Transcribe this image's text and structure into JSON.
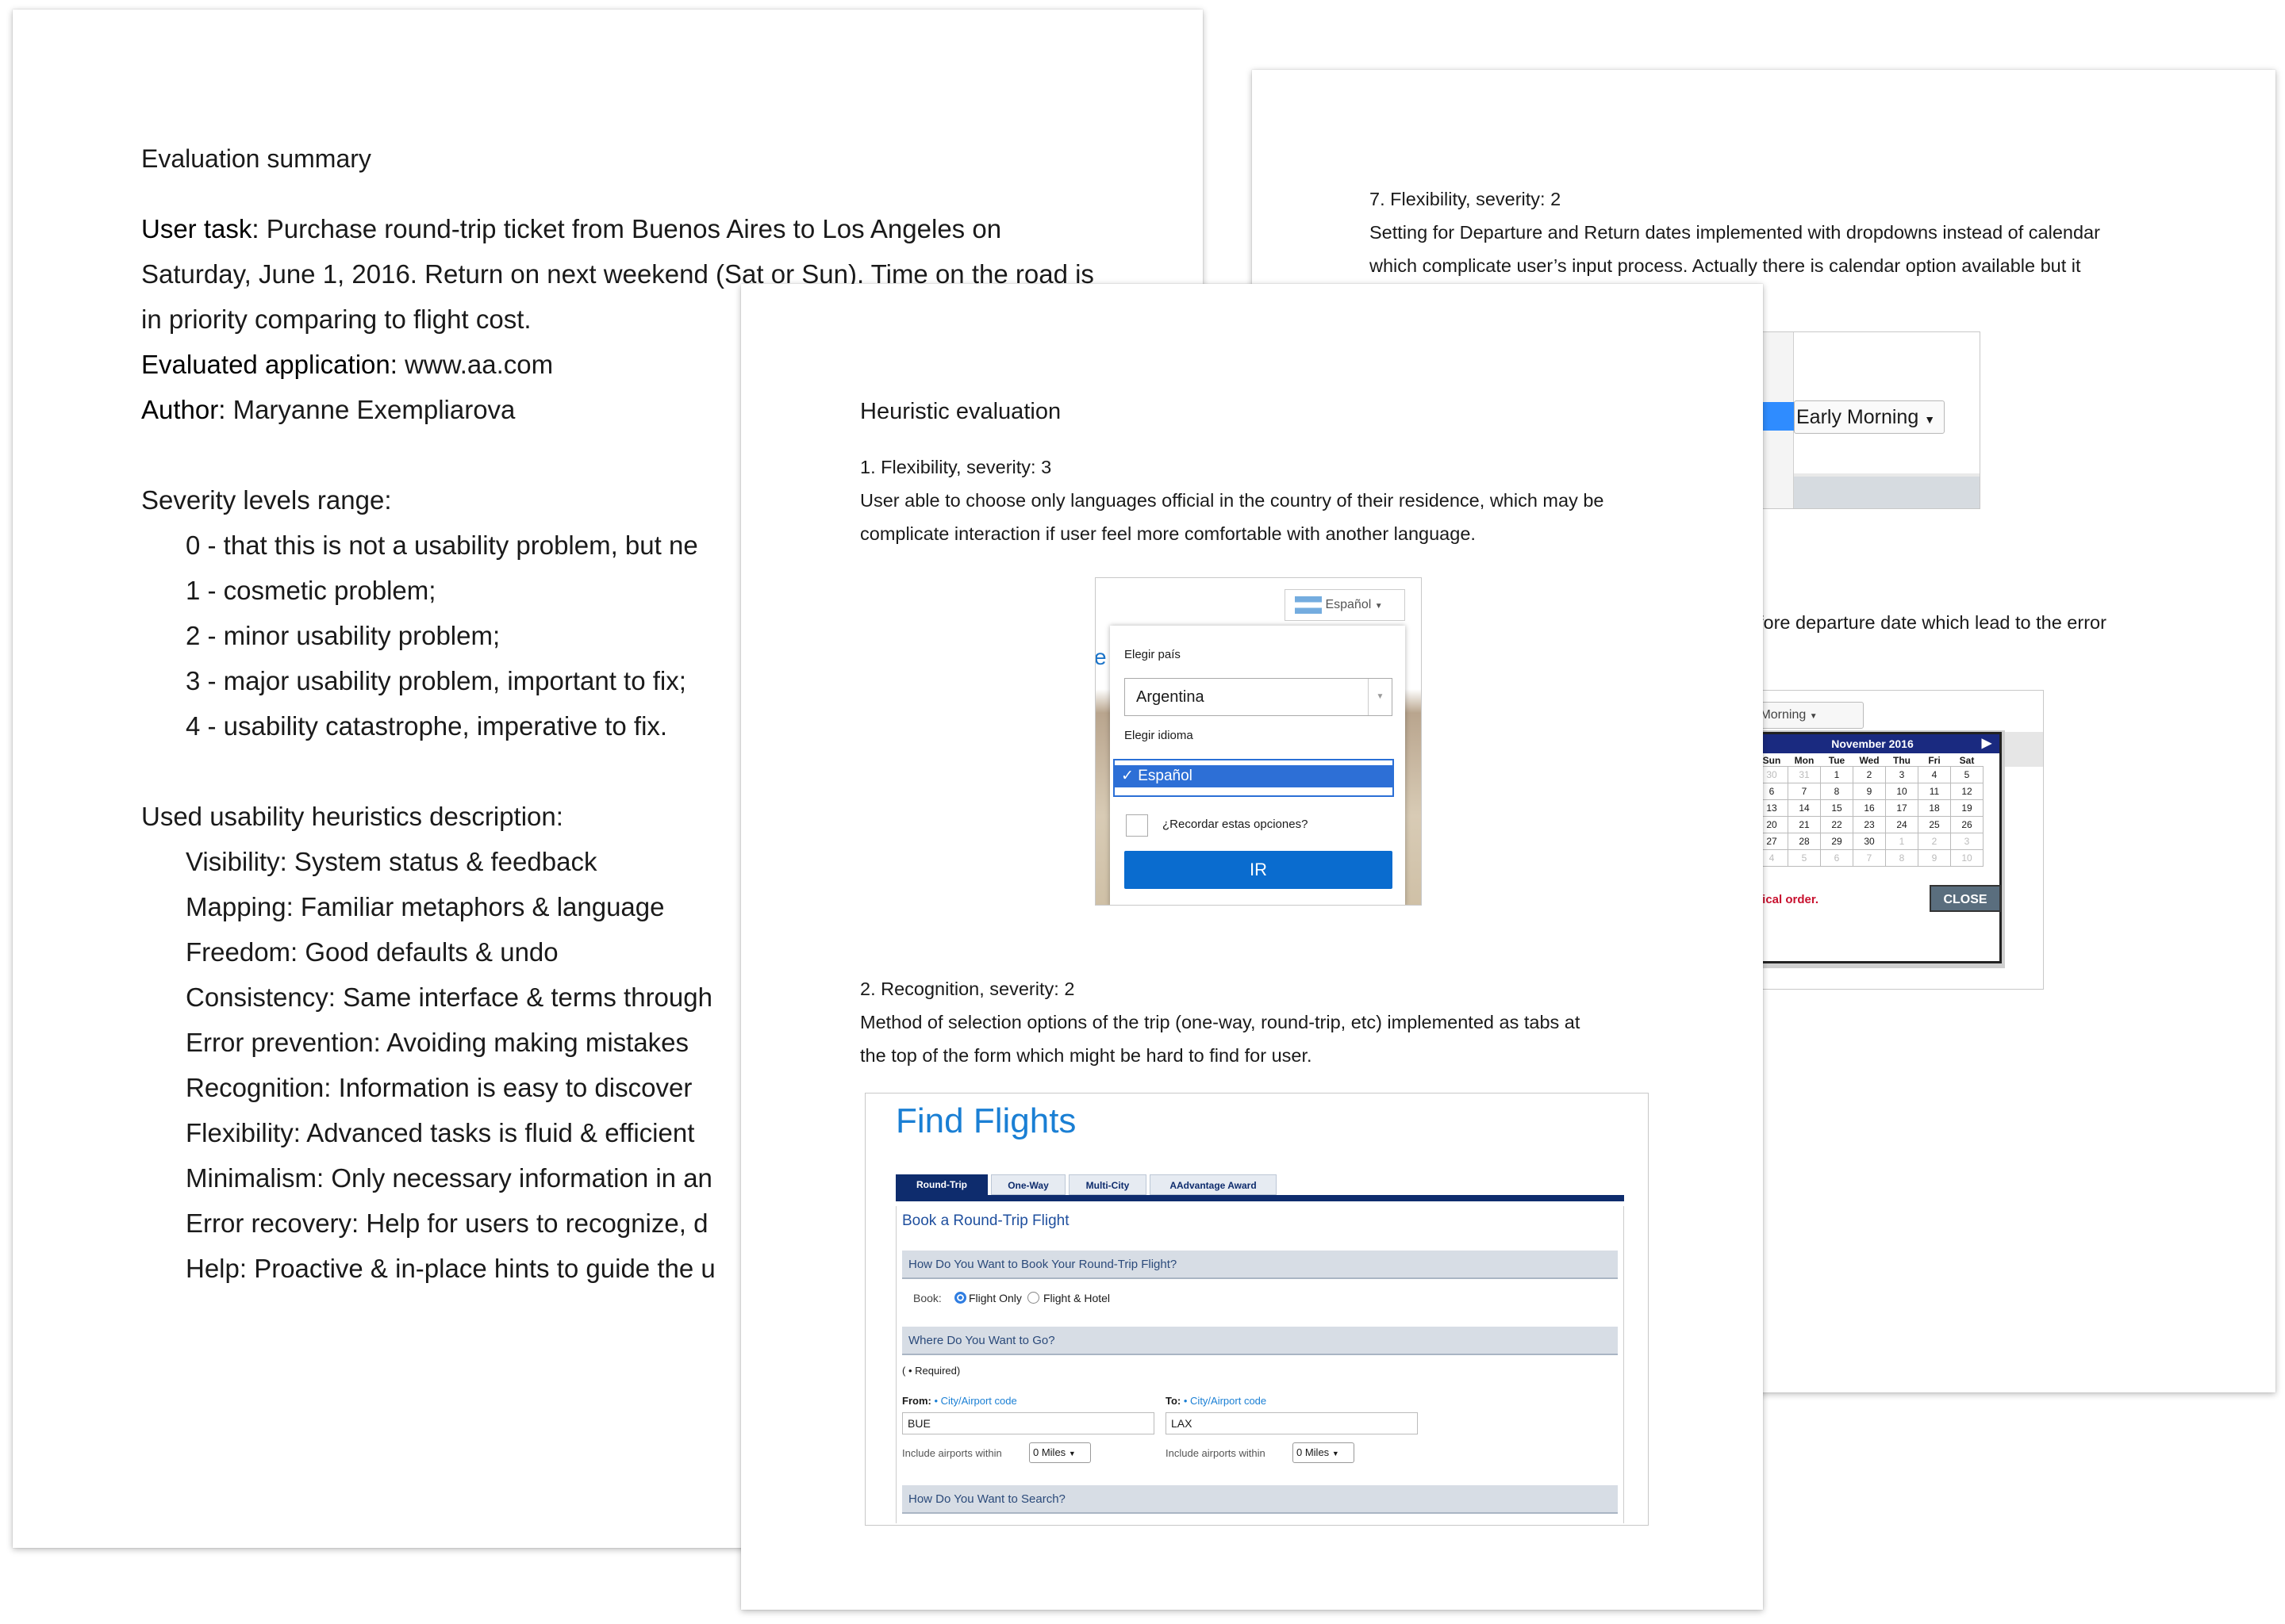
{
  "summary": {
    "title": "Evaluation summary",
    "task_label": "User task:",
    "task_lines": [
      "Purchase round-trip ticket from Buenos Aires to Los Angeles on",
      "Saturday, June 1, 2016. Return on next weekend (Sat or Sun). Time on the road is",
      "in priority comparing to flight cost."
    ],
    "app_label": "Evaluated application:",
    "app_value": "www.aa.com",
    "author_label": "Author:",
    "author_value": "Maryanne Exempliarova",
    "severity_title": "Severity levels range:",
    "severity_levels": [
      "0 - that this is not a usability problem, but ne",
      "1 - cosmetic problem;",
      "2 - minor usability problem;",
      "3 - major usability problem, important to fix;",
      "4 - usability catastrophe, imperative to fix."
    ],
    "heuristics_title": "Used usability heuristics description:",
    "heuristics": [
      "Visibility: System status & feedback",
      "Mapping: Familiar metaphors & language",
      "Freedom: Good defaults & undo",
      "Consistency: Same interface & terms through",
      "Error prevention: Avoiding making mistakes",
      "Recognition: Information is easy to discover",
      "Flexibility: Advanced tasks is fluid & efficient",
      "Minimalism: Only necessary information in an",
      "Error recovery: Help for users to recognize, d",
      "Help: Proactive & in-place hints to guide the u"
    ]
  },
  "heuristic": {
    "title": "Heuristic evaluation",
    "item1_head": "1. Flexibility, severity: 3",
    "item1_lines": [
      "User able to choose only languages official in the country of their residence, which may be",
      "complicate interaction if user feel more comfortable with another language."
    ],
    "item2_head": "2. Recognition, severity: 2",
    "item2_lines": [
      "Method of selection options of the trip (one-way, round-trip, etc) implemented as tabs at",
      "the top of the form which might be hard to find for user."
    ]
  },
  "lang_shot": {
    "lang_btn": "Español",
    "country_label": "Elegir país",
    "country_value": "Argentina",
    "language_label": "Elegir idioma",
    "language_value": "Español",
    "remember": "¿Recordar estas opciones?",
    "go": "IR",
    "bg_letter": "e"
  },
  "flights_shot": {
    "title": "Find Flights",
    "tabs": [
      "Round-Trip",
      "One-Way",
      "Multi-City",
      "AAdvantage Award"
    ],
    "subtitle": "Book a Round-Trip Flight",
    "section1": "How Do You Want to Book Your Round-Trip Flight?",
    "book_label": "Book:",
    "opt1": "Flight Only",
    "opt2": "Flight & Hotel",
    "section2": "Where Do You Want to Go?",
    "required": "( • Required)",
    "from_label": "From:",
    "to_label": "To:",
    "code_link": "• City/Airport code",
    "from_value": "BUE",
    "to_value": "LAX",
    "include_label": "Include airports within",
    "miles": "0 Miles",
    "section3": "How Do You Want to Search?"
  },
  "page3": {
    "item7_head": "7. Flexibility, severity: 2",
    "item7_lines": [
      "Setting for Departure and Return dates implemented with dropdowns instead of calendar",
      "which complicate user’s input process. Actually there is calendar option available but it"
    ],
    "frag_line": "fore departure date which lead to the error",
    "dropdown1": "Early Morning",
    "dropdown2": "y Morning",
    "cal_month": "November 2016",
    "cal_days": [
      "Sun",
      "Mon",
      "Tue",
      "Wed",
      "Thu",
      "Fri",
      "Sat"
    ],
    "cal_rows": [
      [
        "30",
        "31",
        "1",
        "2",
        "3",
        "4",
        "5"
      ],
      [
        "6",
        "7",
        "8",
        "9",
        "10",
        "11",
        "12"
      ],
      [
        "13",
        "14",
        "15",
        "16",
        "17",
        "18",
        "19"
      ],
      [
        "20",
        "21",
        "22",
        "23",
        "24",
        "25",
        "26"
      ],
      [
        "27",
        "28",
        "29",
        "30",
        "1",
        "2",
        "3"
      ],
      [
        "4",
        "5",
        "6",
        "7",
        "8",
        "9",
        "10"
      ]
    ],
    "error_frag": "gical order.",
    "close": "CLOSE"
  }
}
